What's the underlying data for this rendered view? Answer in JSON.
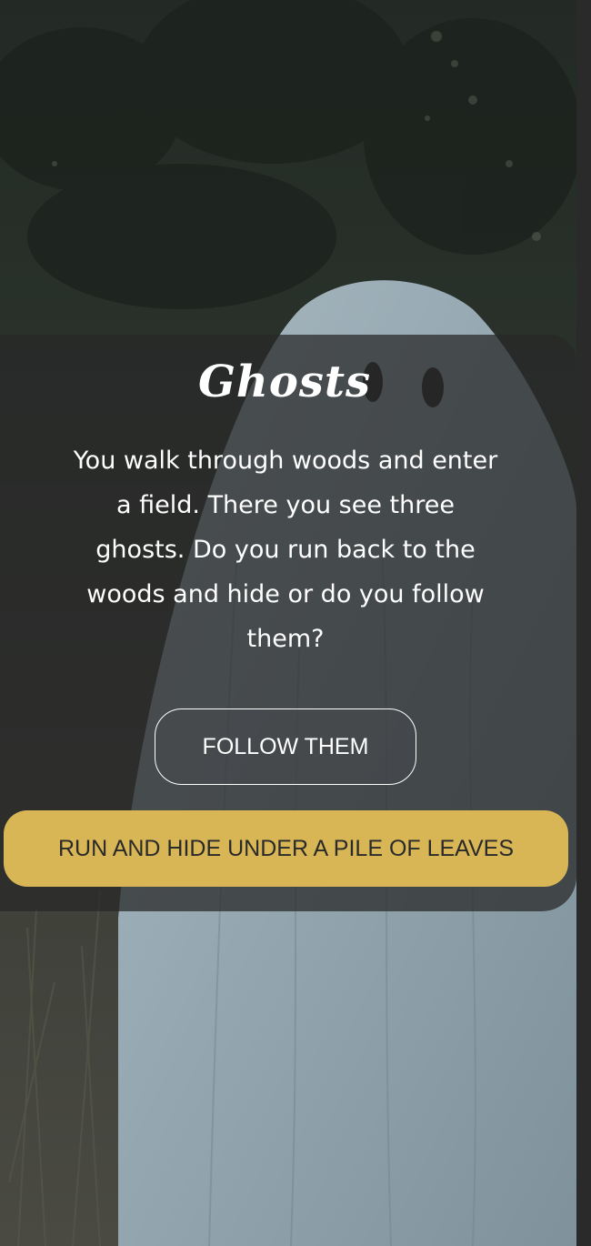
{
  "scene": {
    "background_image": "ghost-in-field-photo",
    "title": "Ghosts",
    "story": "You walk through woods and enter a field. There you see three ghosts. Do you run back to the woods and hide or do you follow them?"
  },
  "choices": {
    "follow_label": "FOLLOW THEM",
    "hide_label": "RUN AND HIDE UNDER A PILE OF LEAVES"
  },
  "colors": {
    "accent_button": "#d8b656",
    "card_overlay": "#282828",
    "text": "#ffffff"
  }
}
